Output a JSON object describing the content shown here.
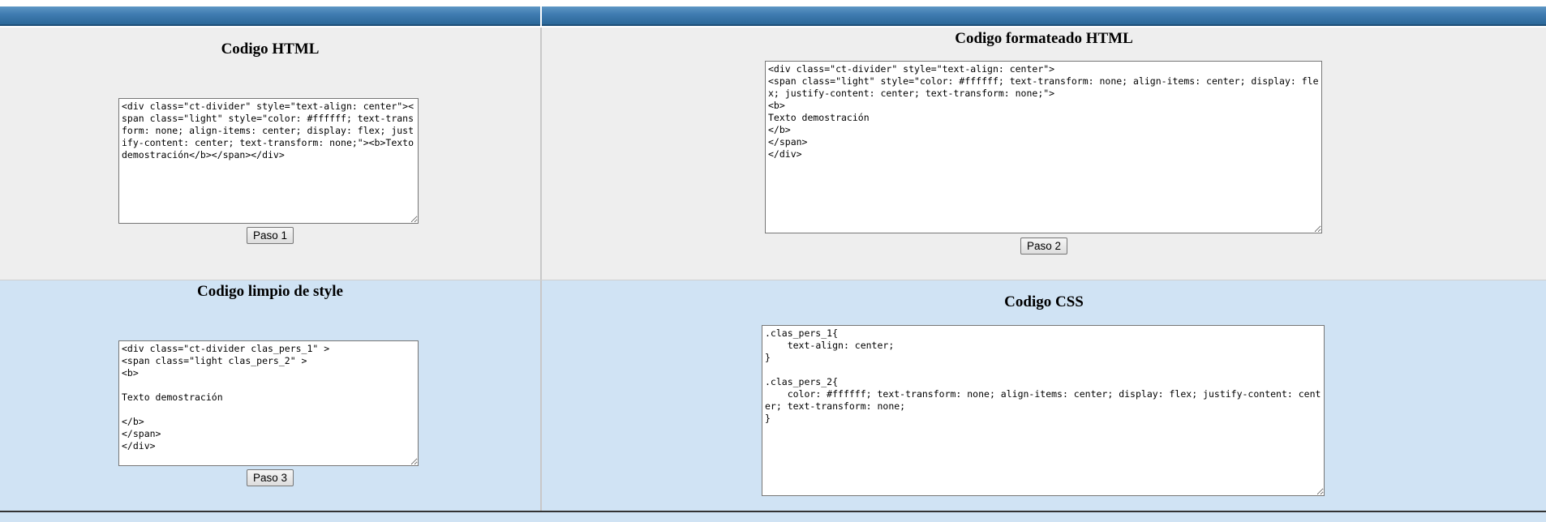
{
  "panels": {
    "html_input": {
      "title": "Codigo HTML",
      "content": "<div class=\"ct-divider\" style=\"text-align: center\"><span class=\"light\" style=\"color: #ffffff; text-transform: none; align-items: center; display: flex; justify-content: center; text-transform: none;\"><b>Texto demostración</b></span></div>",
      "button_label": "Paso 1"
    },
    "html_formatted": {
      "title": "Codigo formateado HTML",
      "content": "<div class=\"ct-divider\" style=\"text-align: center\">\n<span class=\"light\" style=\"color: #ffffff; text-transform: none; align-items: center; display: flex; justify-content: center; text-transform: none;\">\n<b>\nTexto demostración\n</b>\n</span>\n</div>",
      "button_label": "Paso 2"
    },
    "html_clean": {
      "title": "Codigo limpio de style",
      "content": "<div class=\"ct-divider clas_pers_1\" >\n<span class=\"light clas_pers_2\" >\n<b>\n\nTexto demostración\n\n</b>\n</span>\n</div>",
      "button_label": "Paso 3"
    },
    "css_output": {
      "title": "Codigo CSS",
      "content": ".clas_pers_1{\n    text-align: center;\n}\n\n.clas_pers_2{\n    color: #ffffff; text-transform: none; align-items: center; display: flex; justify-content: center; text-transform: none;\n}"
    }
  },
  "colors": {
    "header_bar": "#3f7bb0",
    "panel_gray": "#eeeeee",
    "panel_blue": "#d0e3f4"
  }
}
